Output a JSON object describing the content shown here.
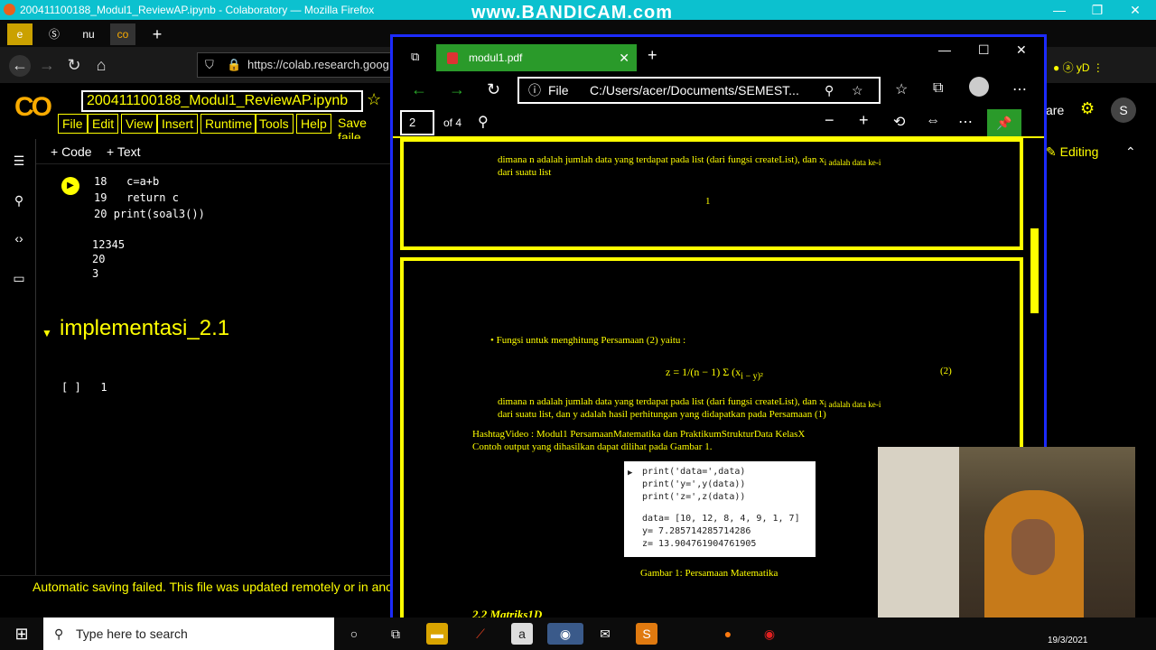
{
  "overlay": {
    "watermark": "www.BANDICAM.com"
  },
  "firefox": {
    "title": "200411100188_Modul1_ReviewAP.ipynb - Colaboratory — Mozilla Firefox",
    "url": "https://colab.research.goog"
  },
  "colab": {
    "notebook_title": "200411100188_Modul1_ReviewAP.ipynb",
    "menu": [
      "File",
      "Edit",
      "View",
      "Insert",
      "Runtime",
      "Tools",
      "Help"
    ],
    "save_status": "Save faile",
    "toolbar": {
      "code": "+ Code",
      "text": "+ Text"
    },
    "code_lines": [
      {
        "n": "18",
        "t": "  c=a+b"
      },
      {
        "n": "19",
        "t": "  return c"
      },
      {
        "n": "20",
        "t": "print(soal3())"
      }
    ],
    "outputs": [
      "12345",
      "20",
      "3"
    ],
    "section_title": "implementasi_2.1",
    "empty_cell": "[ ]   1",
    "status_message": "Automatic saving failed. This file was updated remotely or in anothe",
    "share": "are",
    "avatar": "S",
    "editing": "Editing"
  },
  "edge": {
    "tab_title": "modul1.pdf",
    "address_scheme": "File",
    "address": "C:/Users/acer/Documents/SEMEST...",
    "page_current": "2",
    "page_total": "of 4"
  },
  "pdf": {
    "p1_line1": "dimana n adalah jumlah data yang terdapat pada list (dari fungsi createList), dan x",
    "p1_line1_tail": "i adalah data ke-i",
    "p1_line2": "dari suatu list",
    "page_number": "1",
    "bullet": "• Fungsi untuk menghitung Persamaan (2) yaitu :",
    "formula": "z = 1/(n − 1) Σ (x",
    "formula_tail": "i − y)²",
    "eq_number": "(2)",
    "p2_line1": "dimana n adalah jumlah data yang terdapat pada list (dari fungsi createList), dan x",
    "p2_line1_tail": "i adalah data ke-i",
    "p2_line2": "dari suatu list, dan y adalah hasil perhitungan yang didapatkan pada Persamaan (1)",
    "hashtag": "HashtagVideo : Modul1 PersamaanMatematika dan PraktikumStrukturData KelasX",
    "example": "Contoh output yang dihasilkan dapat dilihat pada Gambar 1.",
    "code_print": [
      "print('data=',data)",
      "print('y=',y(data))",
      "print('z=',z(data))"
    ],
    "code_out": [
      "data= [10, 12, 8, 4, 9, 1, 7]",
      "y= 7.285714285714286",
      "z= 13.904761904761905"
    ],
    "caption": "Gambar 1: Persamaan Matematika",
    "next_section": "2.2   Matriks1D"
  },
  "taskbar": {
    "search_placeholder": "Type here to search",
    "clock_date": "19/3/2021"
  }
}
